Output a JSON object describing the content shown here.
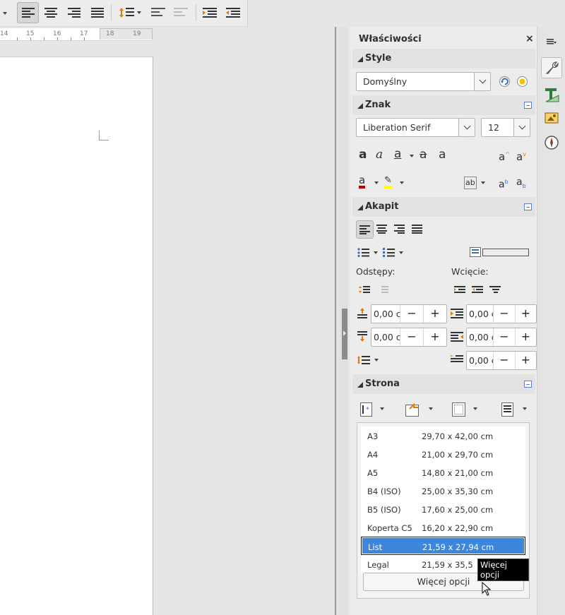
{
  "toolbar": {
    "buttons": [
      "align-left",
      "align-center",
      "align-right",
      "justify",
      "line-spacing",
      "increase-paragraph-spacing",
      "decrease-paragraph-spacing",
      "increase-indent",
      "decrease-indent"
    ]
  },
  "ruler": {
    "numbers": [
      "14",
      "15",
      "16",
      "17",
      "18",
      "19"
    ]
  },
  "sidebar": {
    "title": "Właściwości",
    "close": "×",
    "style_panel": {
      "title": "Style",
      "style_value": "Domyślny"
    },
    "char_panel": {
      "title": "Znak",
      "font_name": "Liberation Serif",
      "font_size": "12"
    },
    "para_panel": {
      "title": "Akapit",
      "spacing_label": "Odstępy:",
      "indent_label": "Wcięcie:",
      "above_spacing": "0,00 c",
      "below_spacing": "0,00 c",
      "before_indent": "0,00 c",
      "after_indent": "0,00 c",
      "first_line_indent": "0,00 c",
      "minus": "−",
      "plus": "+"
    },
    "page_panel": {
      "title": "Strona",
      "sizes": [
        {
          "name": "A3",
          "dims": "29,70 x 42,00 cm"
        },
        {
          "name": "A4",
          "dims": "21,00 x 29,70 cm"
        },
        {
          "name": "A5",
          "dims": "14,80 x 21,00 cm"
        },
        {
          "name": "B4 (ISO)",
          "dims": "25,00 x 35,30 cm"
        },
        {
          "name": "B5 (ISO)",
          "dims": "17,60 x 25,00 cm"
        },
        {
          "name": "Koperta C5",
          "dims": "16,20 x 22,90 cm"
        },
        {
          "name": "List",
          "dims": "21,59 x 27,94 cm"
        },
        {
          "name": "Legal",
          "dims": "21,59 x 35,5"
        }
      ],
      "selected_size": "List",
      "more_options": "Więcej opcji",
      "tooltip": "Więcej opcji"
    }
  },
  "colors": {
    "selection": "#3d86d9",
    "font_color": "#c00000",
    "highlight": "#ffff00"
  }
}
